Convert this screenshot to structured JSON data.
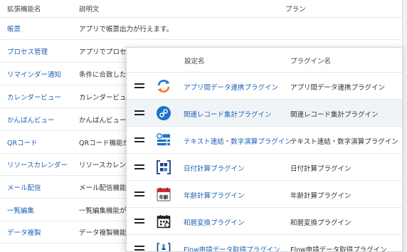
{
  "extensions": {
    "columns": {
      "name": "拡張機能名",
      "description": "説明文",
      "plan": "プラン"
    },
    "rows": [
      {
        "name": "帳票",
        "description": "アプリで帳票出力が行えます。"
      },
      {
        "name": "プロセス管理",
        "description": "アプリでプロセス"
      },
      {
        "name": "リマインダー通知",
        "description": "条件に合致したタ"
      },
      {
        "name": "カレンダービュー",
        "description": "カレンダービュー"
      },
      {
        "name": "かんばんビュー",
        "description": "かんばんビューを"
      },
      {
        "name": "QRコード",
        "description": "QRコード機能が"
      },
      {
        "name": "リソースカレンダー",
        "description": "リソースカレンダ"
      },
      {
        "name": "メール配信",
        "description": "メール配信機能が"
      },
      {
        "name": "一覧編集",
        "description": "一覧編集機能が使"
      },
      {
        "name": "データ複製",
        "description": "データ複製機能"
      }
    ]
  },
  "plugins": {
    "columns": {
      "setting": "設定名",
      "plugin": "プラグイン名"
    },
    "rows": [
      {
        "setting": "アプリ間データ連携プラグイン",
        "plugin": "アプリ間データ連携プラグイン",
        "icon": "sync-icon"
      },
      {
        "setting": "関連レコード集計プラグイン",
        "plugin": "関連レコード集計プラグイン",
        "icon": "link-icon"
      },
      {
        "setting": "テキスト連結・数字演算プラグイン",
        "plugin": "テキスト連結・数字演算プラグイン",
        "icon": "calculator-icon"
      },
      {
        "setting": "日付計算プラグイン",
        "plugin": "日付計算プラグイン",
        "icon": "date-calc-icon"
      },
      {
        "setting": "年齢計算プラグイン",
        "plugin": "年齢計算プラグイン",
        "icon": "age-calendar-icon",
        "badge": "年齢"
      },
      {
        "setting": "和暦変換プラグイン",
        "plugin": "和暦変換プラグイン",
        "icon": "calendar-icon"
      },
      {
        "setting": "Flow申請データ取得プラグイン",
        "plugin": "Flow申請データ取得プラグイン",
        "icon": "flow-icon"
      }
    ]
  },
  "colors": {
    "link": "#1f62b8",
    "accent_blue": "#1a73c9",
    "accent_orange": "#f47a20"
  }
}
